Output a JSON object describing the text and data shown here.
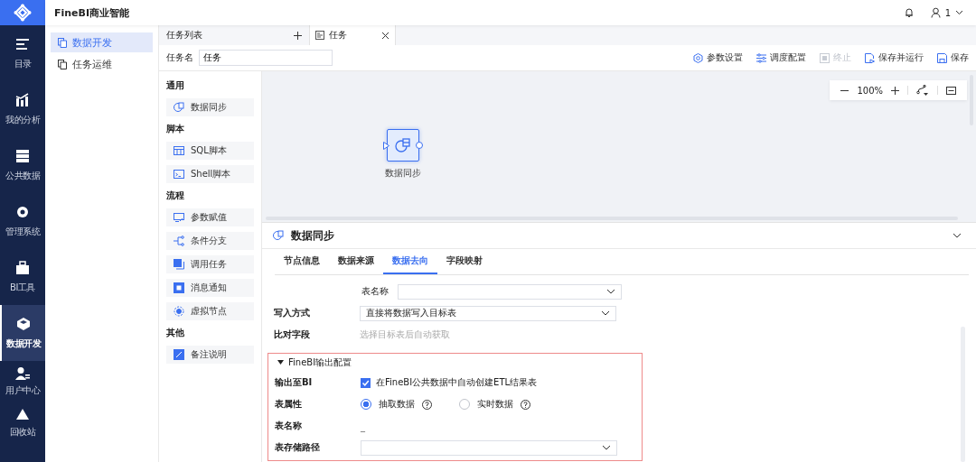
{
  "app": {
    "title": "FineBI商业智能",
    "user": "1"
  },
  "nav": [
    {
      "label": "目录",
      "selected": false
    },
    {
      "label": "我的分析",
      "selected": false
    },
    {
      "label": "公共数据",
      "selected": false
    },
    {
      "label": "管理系统",
      "selected": false
    },
    {
      "label": "BI工具",
      "selected": false
    },
    {
      "label": "数据开发",
      "selected": true
    },
    {
      "label": "用户中心",
      "selected": false
    },
    {
      "label": "回收站",
      "selected": false
    }
  ],
  "subnav": [
    {
      "label": "数据开发",
      "selected": true
    },
    {
      "label": "任务运维",
      "selected": false
    }
  ],
  "task_list_tab": {
    "label": "任务列表"
  },
  "task_tab": {
    "label": "任务"
  },
  "task_name": {
    "label": "任务名",
    "value": "任务"
  },
  "toolbar": [
    {
      "label": "参数设置",
      "disabled": false
    },
    {
      "label": "调度配置",
      "disabled": false
    },
    {
      "label": "终止",
      "disabled": true
    },
    {
      "label": "保存并运行",
      "disabled": false
    },
    {
      "label": "保存",
      "disabled": false
    }
  ],
  "palette": [
    {
      "title": "通用",
      "items": [
        {
          "label": "数据同步"
        }
      ]
    },
    {
      "title": "脚本",
      "items": [
        {
          "label": "SQL脚本"
        },
        {
          "label": "Shell脚本"
        }
      ]
    },
    {
      "title": "流程",
      "items": [
        {
          "label": "参数赋值"
        },
        {
          "label": "条件分支"
        },
        {
          "label": "调用任务"
        },
        {
          "label": "消息通知"
        },
        {
          "label": "虚拟节点"
        }
      ]
    },
    {
      "title": "其他",
      "items": [
        {
          "label": "备注说明"
        }
      ]
    }
  ],
  "canvas": {
    "zoom": "100%",
    "nodes": [
      {
        "label": "数据同步",
        "selected": true
      }
    ]
  },
  "panel": {
    "title": "数据同步",
    "tabs": [
      {
        "label": "节点信息",
        "selected": false
      },
      {
        "label": "数据来源",
        "selected": false
      },
      {
        "label": "数据去向",
        "selected": true
      },
      {
        "label": "字段映射",
        "selected": false
      }
    ],
    "fields": [
      {
        "kind": "inline-select",
        "label": "表名称"
      },
      {
        "kind": "select",
        "label": "写入方式",
        "value": "直接将数据写入目标表"
      },
      {
        "kind": "hint",
        "label": "比对字段",
        "placeholder": "选择目标表后自动获取"
      }
    ],
    "bi_output": {
      "title": "FineBI输出配置",
      "expanded": true,
      "rows": [
        {
          "kind": "checkbox",
          "label": "输出至BI",
          "text": "在FineBI公共数据中自动创建ETL结果表",
          "checked": true
        },
        {
          "kind": "radio",
          "label": "表属性",
          "options": [
            {
              "label": "抽取数据",
              "selected": true
            },
            {
              "label": "实时数据",
              "selected": false
            }
          ]
        },
        {
          "kind": "text",
          "label": "表名称",
          "value": "_"
        },
        {
          "kind": "select",
          "label": "表存储路径"
        }
      ]
    }
  }
}
